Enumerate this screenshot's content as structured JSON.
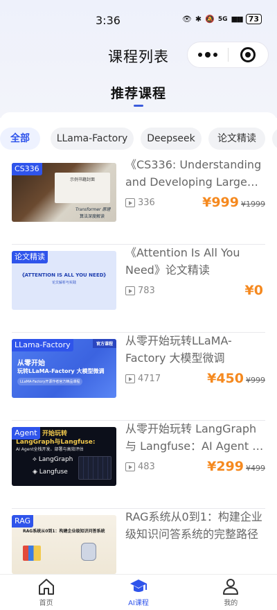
{
  "status_bar": {
    "time": "3:36",
    "network": "5G",
    "battery": "73"
  },
  "nav": {
    "title": "课程列表"
  },
  "section": {
    "title": "推荐课程"
  },
  "chips": [
    {
      "label": "全部",
      "active": true
    },
    {
      "label": "LLama-Factory",
      "active": false
    },
    {
      "label": "Deepseek",
      "active": false
    },
    {
      "label": "论文精读",
      "active": false
    }
  ],
  "courses": [
    {
      "tag": "CS336",
      "thumb_text": [
        "示例书籍封面",
        "Transformer 原理",
        "算法深度解读"
      ],
      "title_line1": "《CS336: Understanding",
      "title_line2": "and Developing Large…",
      "views": "336",
      "price": "¥999",
      "old_price": "¥1999"
    },
    {
      "tag": "论文精读",
      "thumb_text": [
        "《ATTENTION IS ALL YOU NEED》",
        "论文解析与实践"
      ],
      "title_line1": "《Attention Is All You",
      "title_line2": "Need》论文精读",
      "views": "783",
      "price": "¥0",
      "old_price": ""
    },
    {
      "tag": "LLama-Factory",
      "thumb_text": [
        "官方课程",
        "从零开始",
        "玩转LLaMA-Factory 大模型微调",
        "LLaMA-Factory开源作者官方精品课程"
      ],
      "title_line1": "从零开始玩转LLaMA-",
      "title_line2": "Factory 大模型微调",
      "views": "4717",
      "price": "¥450",
      "old_price": "¥999"
    },
    {
      "tag": "Agent",
      "thumb_text": [
        "开始玩转",
        "LangGraph与Langfuse:",
        "AI Agent全栈开发、部署与高效评估",
        "LangGraph",
        "Langfuse"
      ],
      "title_line1": "从零开始玩转 LangGraph",
      "title_line2": "与 Langfuse：AI Agent …",
      "views": "483",
      "price": "¥299",
      "old_price": "¥499"
    },
    {
      "tag": "RAG",
      "thumb_text": [
        "RAG系统从0到1：构建企业级知识问答系统"
      ],
      "title_line1": "RAG系统从0到1：构建企业",
      "title_line2": "级知识问答系统的完整路径",
      "views": "",
      "price": "",
      "old_price": ""
    }
  ],
  "tabbar": [
    {
      "label": "首页",
      "icon": "home-icon",
      "active": false
    },
    {
      "label": "AI课程",
      "icon": "graduation-cap-icon",
      "active": true
    },
    {
      "label": "我的",
      "icon": "user-icon",
      "active": false
    }
  ],
  "colors": {
    "accent": "#2f54eb",
    "price": "#f5891f"
  }
}
